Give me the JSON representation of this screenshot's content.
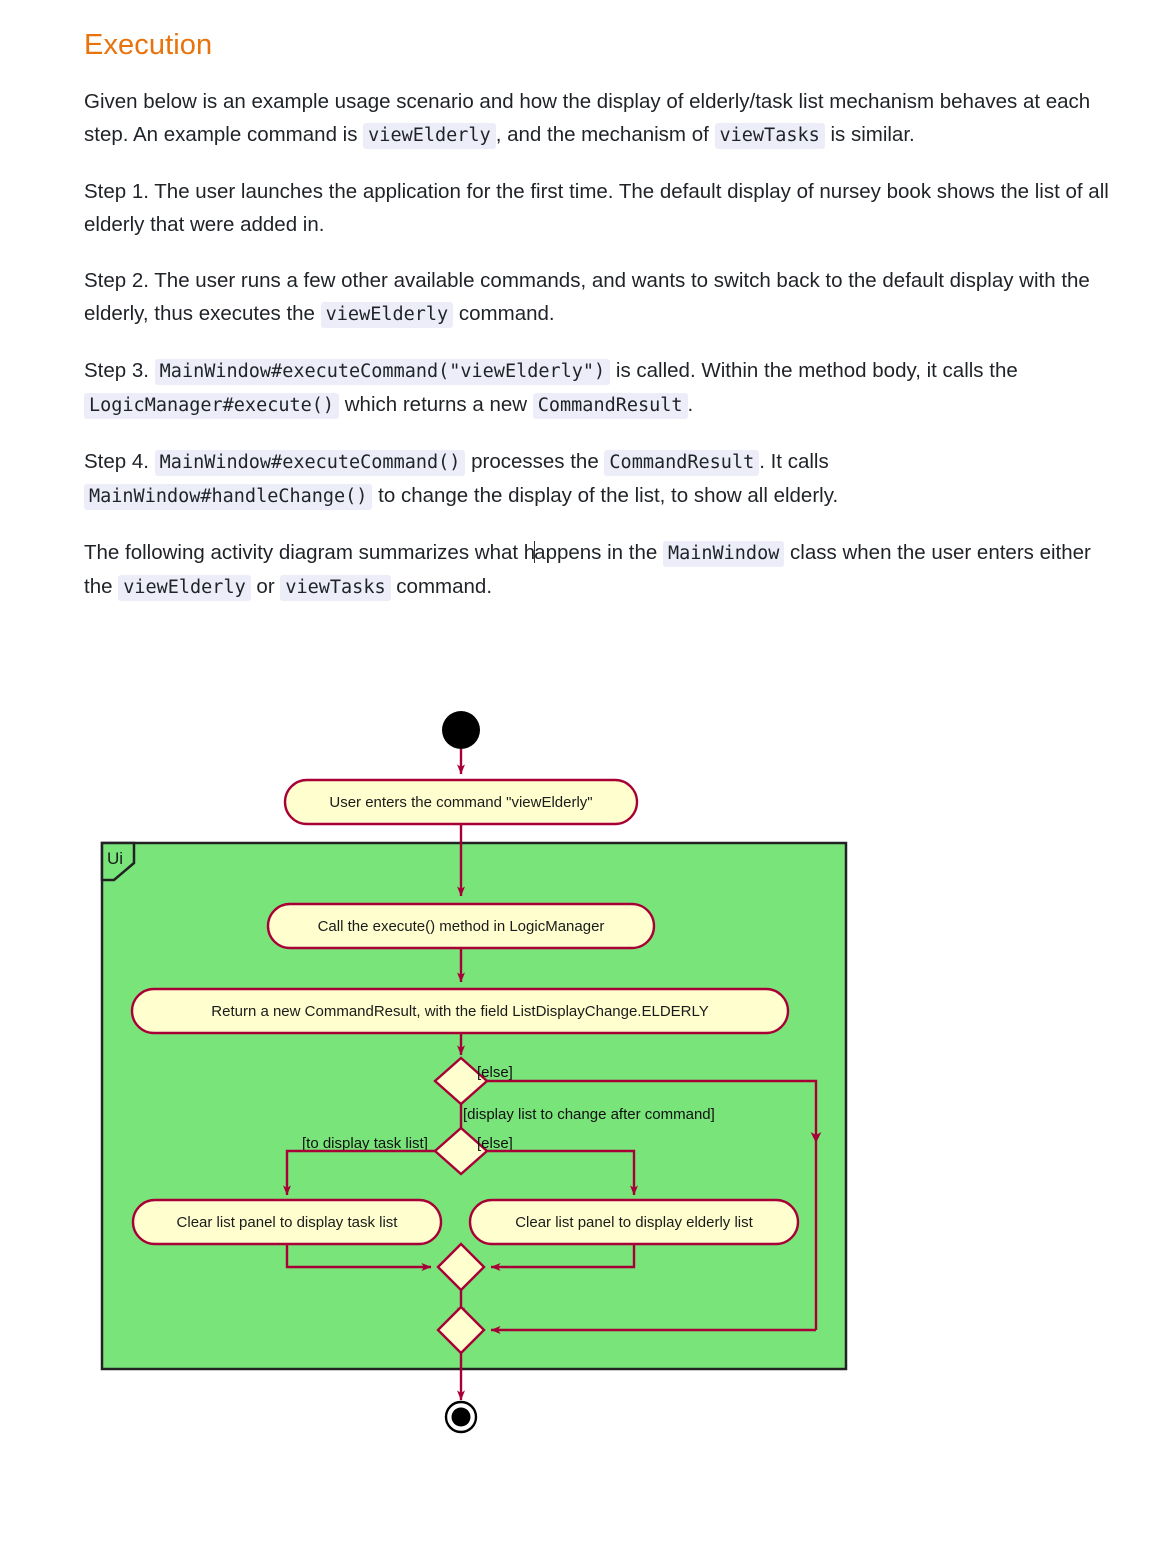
{
  "heading": "Execution",
  "paragraphs": {
    "intro": {
      "t1": "Given below is an example usage scenario and how the display of elderly/task list mechanism behaves at each step. An example command is ",
      "c1": "viewElderly",
      "t2": ", and the mechanism of ",
      "c2": "viewTasks",
      "t3": " is similar."
    },
    "step1": {
      "t1": "Step 1. The user launches the application for the first time. The default display of nursey book shows the list of all elderly that were added in."
    },
    "step2": {
      "t1": "Step 2. The user runs a few other available commands, and wants to switch back to the default display with the elderly, thus executes the ",
      "c1": "viewElderly",
      "t2": " command."
    },
    "step3": {
      "t1": "Step 3. ",
      "c1": "MainWindow#executeCommand(\"viewElderly\")",
      "t2": " is called. Within the method body, it calls the ",
      "c2": "LogicManager#execute()",
      "t3": " which returns a new ",
      "c3": "CommandResult",
      "t4": "."
    },
    "step4": {
      "t1": "Step 4. ",
      "c1": "MainWindow#executeCommand()",
      "t2": " processes the ",
      "c2": "CommandResult",
      "t3": ". It calls ",
      "c3": "MainWindow#handleChange()",
      "t4": " to change the display of the list, to show all elderly."
    },
    "summary": {
      "t1": "The following activity diagram summarizes what h",
      "t1b": "appens in the ",
      "c1": "MainWindow",
      "t2": " class when the user enters either the ",
      "c2": "viewElderly",
      "t3": " or ",
      "c3": "viewTasks",
      "t4": " command."
    }
  },
  "diagram": {
    "title": "activity-diagram-view-list",
    "partition_label": "Ui",
    "colors": {
      "node_fill": "#fefece",
      "node_stroke": "#a80036",
      "arrow": "#a80036",
      "partition_fill": "#79e47a",
      "partition_stroke": "#222222",
      "start_end": "#000000"
    },
    "nodes": {
      "user_enters": "User enters the command \"viewElderly\"",
      "call_execute": "Call the execute() method in LogicManager",
      "return_result": "Return a new CommandResult, with the field ListDisplayChange.ELDERLY",
      "clear_task": "Clear list panel to display task list",
      "clear_elderly": "Clear list panel to display elderly list"
    },
    "guards": {
      "else_outer": "[else]",
      "display_change": "[display list to change after command]",
      "to_task_list": "[to display task list]",
      "else_inner": "[else]"
    }
  }
}
